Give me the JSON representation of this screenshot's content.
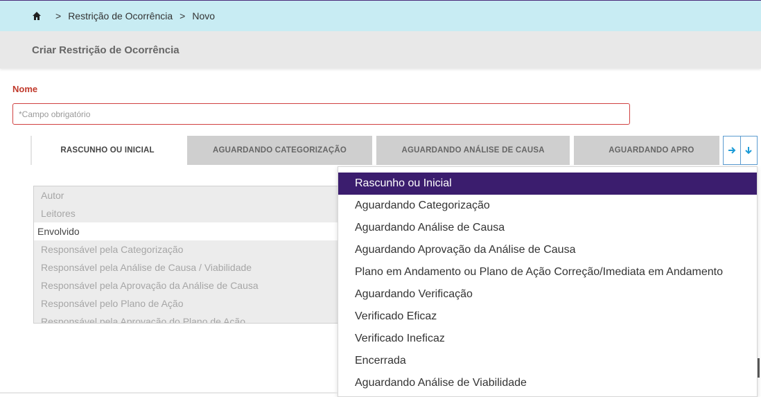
{
  "breadcrumb": {
    "separator": ">",
    "items": [
      "Restrição de Ocorrência",
      "Novo"
    ]
  },
  "page_title": "Criar Restrição de Ocorrência",
  "form": {
    "name_label": "Nome",
    "name_placeholder": "*Campo obrigatório",
    "name_value": ""
  },
  "tabs": [
    {
      "label": "RASCUNHO OU INICIAL",
      "active": true
    },
    {
      "label": "AGUARDANDO CATEGORIZAÇÃO",
      "active": false
    },
    {
      "label": "AGUARDANDO ANÁLISE DE CAUSA",
      "active": false
    },
    {
      "label": "AGUARDANDO APRO",
      "active": false
    }
  ],
  "tab_nav": {
    "next_icon": "arrow-right-icon",
    "dropdown_icon": "arrow-down-icon",
    "color": "#1a9bd7"
  },
  "field_list": [
    {
      "label": "Autor",
      "selected": false
    },
    {
      "label": "Leitores",
      "selected": false
    },
    {
      "label": "Envolvido",
      "selected": true
    },
    {
      "label": "Responsável pela Categorização",
      "selected": false
    },
    {
      "label": "Responsável pela Análise de Causa / Viabilidade",
      "selected": false
    },
    {
      "label": "Responsável pela Aprovação da Análise de Causa",
      "selected": false
    },
    {
      "label": "Responsável pelo Plano de Ação",
      "selected": false
    },
    {
      "label": "Responsável pela Aprovação do Plano de Ação",
      "selected": false
    }
  ],
  "dropdown": {
    "items": [
      {
        "label": "Rascunho ou Inicial",
        "active": true
      },
      {
        "label": "Aguardando Categorização",
        "active": false
      },
      {
        "label": "Aguardando Análise de Causa",
        "active": false
      },
      {
        "label": "Aguardando Aprovação da Análise de Causa",
        "active": false
      },
      {
        "label": "Plano em Andamento ou Plano de Ação Correção/Imediata em Andamento",
        "active": false
      },
      {
        "label": "Aguardando Verificação",
        "active": false
      },
      {
        "label": "Verificado Eficaz",
        "active": false
      },
      {
        "label": "Verificado Ineficaz",
        "active": false
      },
      {
        "label": "Encerrada",
        "active": false
      },
      {
        "label": "Aguardando Análise de Viabilidade",
        "active": false
      }
    ],
    "active_color": "#3b1d6e"
  },
  "colors": {
    "breadcrumb_bg": "#c8ecf3",
    "required_label": "#c0392b",
    "accent": "#1a9bd7"
  }
}
